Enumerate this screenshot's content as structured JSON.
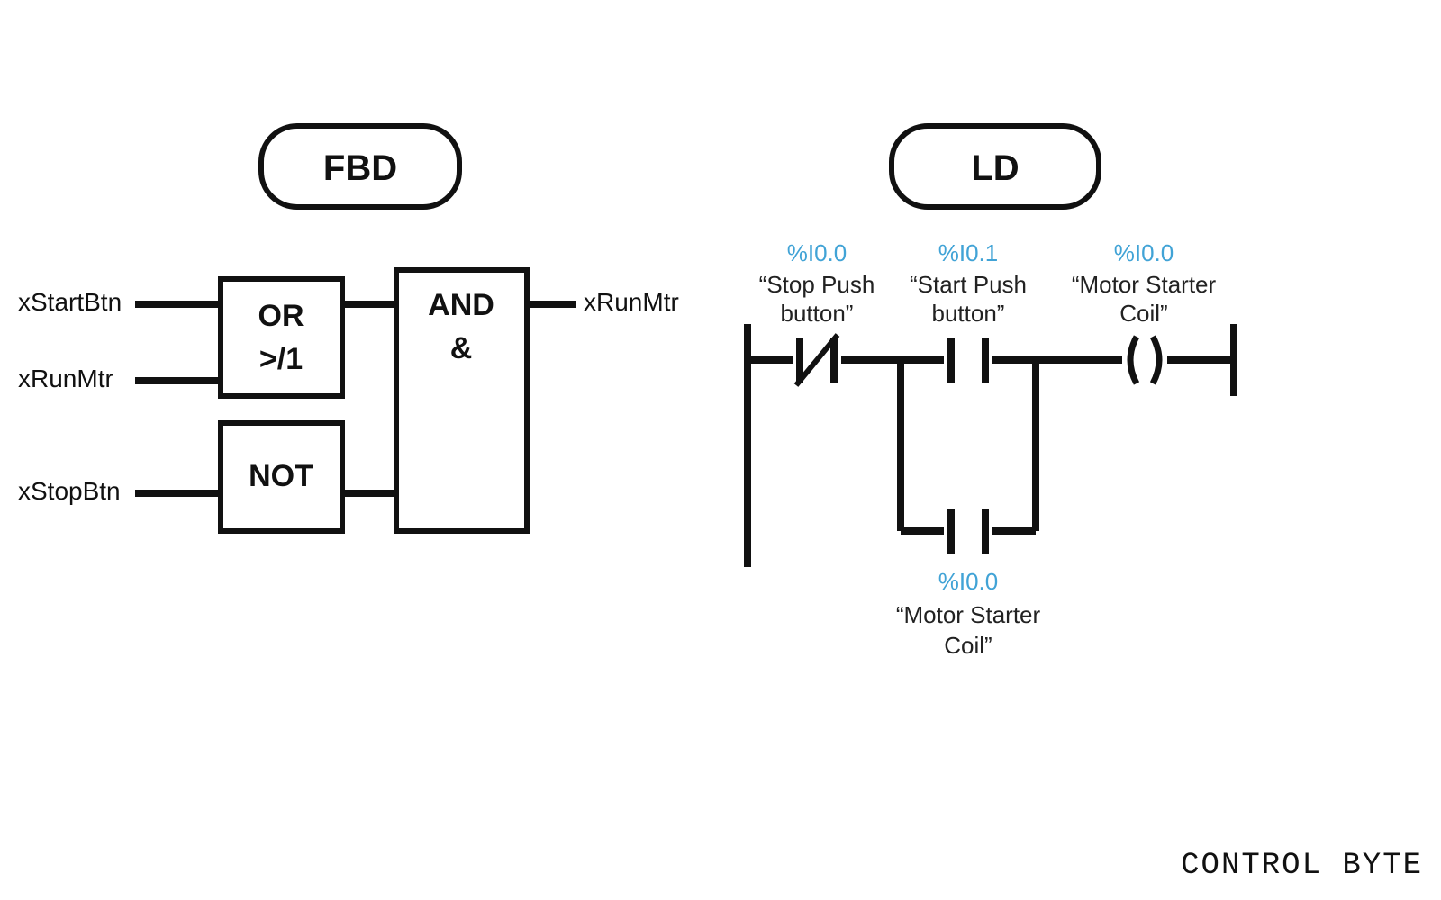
{
  "left": {
    "title": "FBD",
    "inputs": {
      "a": "xStartBtn",
      "b": "xRunMtr",
      "c": "xStopBtn"
    },
    "output": "xRunMtr",
    "blocks": {
      "or_line1": "OR",
      "or_line2": ">/1",
      "not": "NOT",
      "and_line1": "AND",
      "and_line2": "&"
    }
  },
  "right": {
    "title": "LD",
    "stop": {
      "addr": "%I0.0",
      "l1": "“Stop Push",
      "l2": "button”"
    },
    "start": {
      "addr": "%I0.1",
      "l1": "“Start Push",
      "l2": "button”"
    },
    "coil": {
      "addr": "%I0.0",
      "l1": "“Motor Starter",
      "l2": "Coil”"
    },
    "latch": {
      "addr": "%I0.0",
      "l1": "“Motor Starter",
      "l2": "Coil”"
    }
  },
  "brand": "CONTROL BYTE"
}
